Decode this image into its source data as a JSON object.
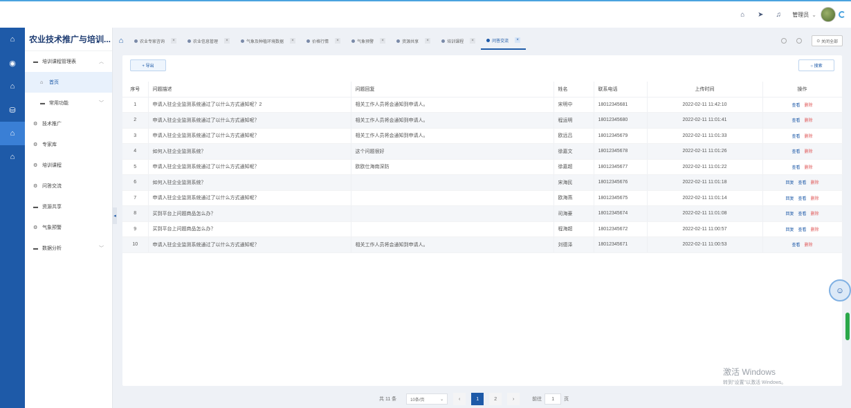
{
  "header": {
    "user": "管理员"
  },
  "sidebar": {
    "title": "农业技术推广与培训...",
    "items": [
      {
        "label": "培训课程管理表",
        "icon": "folder-icon",
        "arrow": "︿",
        "level": 0
      },
      {
        "label": "首页",
        "icon": "home-icon",
        "level": 1,
        "active": true
      },
      {
        "label": "常用功能",
        "icon": "folder-icon",
        "arrow": "﹀",
        "level": 1
      },
      {
        "label": "技术推广",
        "icon": "gear-icon",
        "level": 0
      },
      {
        "label": "专家库",
        "icon": "gear-icon",
        "level": 0
      },
      {
        "label": "培训课程",
        "icon": "gear-icon",
        "level": 0
      },
      {
        "label": "问答交流",
        "icon": "gear-icon",
        "level": 0
      },
      {
        "label": "资源共享",
        "icon": "folder-icon",
        "level": 0
      },
      {
        "label": "气象预警",
        "icon": "gear-icon",
        "level": 0
      },
      {
        "label": "数据分析",
        "icon": "folder-icon",
        "arrow": "﹀",
        "level": 0
      }
    ]
  },
  "tabs": [
    {
      "label": "农业专家咨询",
      "active": false
    },
    {
      "label": "农业信息管理",
      "active": false
    },
    {
      "label": "气象及种植环境数据",
      "active": false
    },
    {
      "label": "价格行情",
      "active": false
    },
    {
      "label": "气象预警",
      "active": false
    },
    {
      "label": "资源共享",
      "active": false
    },
    {
      "label": "培训课程",
      "active": false
    },
    {
      "label": "问答交流",
      "active": true
    }
  ],
  "tabs_close_all": "关闭全部",
  "toolbar": {
    "export_label": "+ 导出",
    "search_label": "○ 搜索"
  },
  "table": {
    "headers": [
      "序号",
      "问题描述",
      "问题回复",
      "姓名",
      "联系电话",
      "上传时间",
      "操作"
    ],
    "rows": [
      {
        "no": "1",
        "q": "申请入驻企业监测系统通过了以什么方式通知呢？2",
        "a": "相关工作人员将会通知到申请人。",
        "name": "宋明中",
        "phone": "18012345681",
        "time": "2022-02-11 11:42:10",
        "ops": [
          "查看",
          "删除"
        ]
      },
      {
        "no": "2",
        "q": "申请入驻企业监测系统通过了以什么方式通知呢？",
        "a": "相关工作人员将会通知到申请人。",
        "name": "程运明",
        "phone": "18012345680",
        "time": "2022-02-11 11:01:41",
        "ops": [
          "查看",
          "删除"
        ]
      },
      {
        "no": "3",
        "q": "申请入驻企业监测系统通过了以什么方式通知呢？",
        "a": "相关工作人员将会通知到申请人。",
        "name": "欧远吕",
        "phone": "18012345679",
        "time": "2022-02-11 11:01:33",
        "ops": [
          "查看",
          "删除"
        ]
      },
      {
        "no": "4",
        "q": "如何入驻企业监测系统？",
        "a": "这个问题很好",
        "name": "徐嘉文",
        "phone": "18012345678",
        "time": "2022-02-11 11:01:26",
        "ops": [
          "查看",
          "删除"
        ]
      },
      {
        "no": "5",
        "q": "申请入驻企业监测系统通过了以什么方式通知呢？",
        "a": "欧欧仕海南深防",
        "name": "徐嘉超",
        "phone": "18012345677",
        "time": "2022-02-11 11:01:22",
        "ops": [
          "查看",
          "删除"
        ]
      },
      {
        "no": "6",
        "q": "如何入驻企业监测系统？",
        "a": "",
        "name": "宋海民",
        "phone": "18012345676",
        "time": "2022-02-11 11:01:18",
        "ops": [
          "回复",
          "查看",
          "删除"
        ]
      },
      {
        "no": "7",
        "q": "申请入驻企业监测系统通过了以什么方式通知呢？",
        "a": "",
        "name": "欧海燕",
        "phone": "18012345675",
        "time": "2022-02-11 11:01:14",
        "ops": [
          "回复",
          "查看",
          "删除"
        ]
      },
      {
        "no": "8",
        "q": "买到平台上问题商品怎么办？",
        "a": "",
        "name": "司海豪",
        "phone": "18012345674",
        "time": "2022-02-11 11:01:08",
        "ops": [
          "回复",
          "查看",
          "删除"
        ]
      },
      {
        "no": "9",
        "q": "买到平台上问题商品怎么办？",
        "a": "",
        "name": "程海超",
        "phone": "18012345672",
        "time": "2022-02-11 11:00:57",
        "ops": [
          "回复",
          "查看",
          "删除"
        ]
      },
      {
        "no": "10",
        "q": "申请入驻企业监测系统通过了以什么方式通知呢？",
        "a": "相关工作人员将会通知到申请人。",
        "name": "刘德泽",
        "phone": "18012345671",
        "time": "2022-02-11 11:00:53",
        "ops": [
          "查看",
          "删除"
        ]
      }
    ]
  },
  "pagination": {
    "total": "共 11 条",
    "page_size": "10条/页",
    "prev": "‹",
    "pages": [
      "1",
      "2"
    ],
    "current": "1",
    "next": "›",
    "goto_label": "前往",
    "goto_value": "1",
    "goto_suffix": "页"
  },
  "watermark": {
    "title": "激活 Windows",
    "subtitle": "转到\"设置\"以激活 Windows。"
  }
}
